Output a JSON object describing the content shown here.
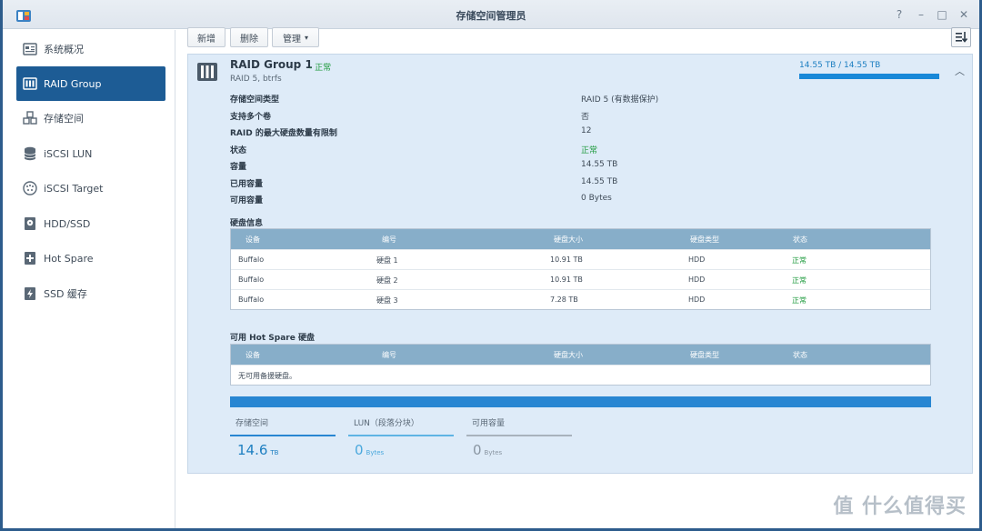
{
  "window": {
    "title": "存储空间管理员",
    "controls": [
      "?",
      "–",
      "□",
      "✕"
    ]
  },
  "sidebar": {
    "items": [
      {
        "label": "系统概况",
        "icon": "overview-icon"
      },
      {
        "label": "RAID Group",
        "icon": "raid-icon",
        "active": true
      },
      {
        "label": "存储空间",
        "icon": "cubes-icon"
      },
      {
        "label": "iSCSI LUN",
        "icon": "database-icon"
      },
      {
        "label": "iSCSI Target",
        "icon": "globe-icon"
      },
      {
        "label": "HDD/SSD",
        "icon": "hdd-icon"
      },
      {
        "label": "Hot Spare",
        "icon": "plus-disk-icon"
      },
      {
        "label": "SSD 缓存",
        "icon": "ssd-cache-icon"
      }
    ]
  },
  "toolbar": {
    "create_label": "新增",
    "delete_label": "删除",
    "manage_label": "管理",
    "manage_caret": "▾"
  },
  "raid": {
    "title": "RAID Group 1",
    "status_prefix": "-",
    "status": "正常",
    "subtitle": "RAID 5, btrfs",
    "usage_text": "14.55 TB / 14.55 TB",
    "usage_fraction": 1.0,
    "collapse_glyph": "︿",
    "properties": [
      {
        "label": "存储空间类型",
        "value": "RAID 5 (有数据保护)"
      },
      {
        "label": "支持多个卷",
        "value": "否"
      },
      {
        "label": "RAID 的最大硬盘数量有限制",
        "value": "12"
      },
      {
        "label": "状态",
        "value": "正常",
        "status": "ok"
      },
      {
        "label": "容量",
        "value": "14.55 TB"
      },
      {
        "label": "已用容量",
        "value": "14.55 TB"
      },
      {
        "label": "可用容量",
        "value": "0 Bytes"
      }
    ],
    "disk_info": {
      "title": "硬盘信息",
      "headers": [
        "设备",
        "编号",
        "硬盘大小",
        "硬盘类型",
        "状态"
      ],
      "rows": [
        [
          "Buffalo",
          "硬盘 1",
          "10.91 TB",
          "HDD",
          "正常"
        ],
        [
          "Buffalo",
          "硬盘 2",
          "10.91 TB",
          "HDD",
          "正常"
        ],
        [
          "Buffalo",
          "硬盘 3",
          "7.28 TB",
          "HDD",
          "正常"
        ]
      ]
    },
    "hot_spare": {
      "title": "可用 Hot Spare 硬盘",
      "headers": [
        "设备",
        "编号",
        "硬盘大小",
        "硬盘类型",
        "状态"
      ],
      "empty_text": "无可用备援硬盘。"
    },
    "stats": [
      {
        "label": "存储空间",
        "value": "14.6",
        "unit": "TB",
        "color": "#1d7fc1",
        "line": "#2886d2"
      },
      {
        "label": "LUN（段落分块）",
        "value": "0",
        "unit": "Bytes",
        "color": "#4aa8dd",
        "line": "#5fb4e4"
      },
      {
        "label": "可用容量",
        "value": "0",
        "unit": "Bytes",
        "color": "#8a96a2",
        "line": "#a8b2bc"
      }
    ]
  },
  "watermark": "值 什么值得买"
}
